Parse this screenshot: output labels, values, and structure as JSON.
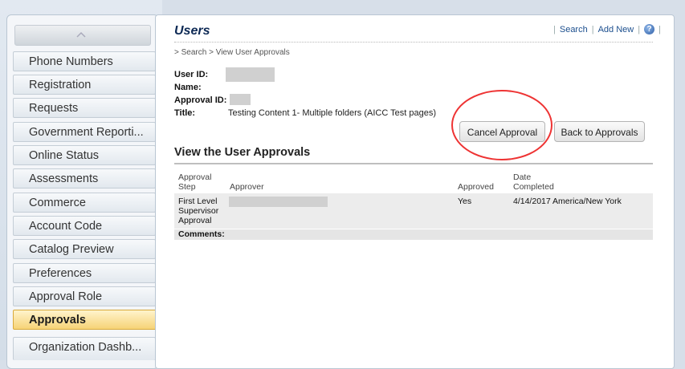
{
  "sidebar": {
    "items": [
      {
        "label": "Phone Numbers"
      },
      {
        "label": "Registration"
      },
      {
        "label": "Requests"
      },
      {
        "label": "Government Reporti..."
      },
      {
        "label": "Online Status"
      },
      {
        "label": "Assessments"
      },
      {
        "label": "Commerce"
      },
      {
        "label": "Account Code"
      },
      {
        "label": "Catalog Preview"
      },
      {
        "label": "Preferences"
      },
      {
        "label": "Approval Role"
      },
      {
        "label": "Approvals",
        "selected": true
      },
      {
        "label": "Organization Dashb..."
      }
    ]
  },
  "header": {
    "title": "Users",
    "links": {
      "search": "Search",
      "add_new": "Add New"
    },
    "help_icon": "help-icon"
  },
  "breadcrumb": "> Search > View User Approvals",
  "details": {
    "user_id_label": "User ID:",
    "name_label": "Name:",
    "approval_id_label": "Approval ID:",
    "title_label": "Title:",
    "title_value": "Testing Content 1- Multiple folders (AICC Test pages)"
  },
  "buttons": {
    "cancel_approval": "Cancel Approval",
    "back_to_approvals": "Back to Approvals"
  },
  "section": {
    "title": "View the User Approvals",
    "columns": {
      "approval_step": "Approval Step",
      "approver": "Approver",
      "approved": "Approved",
      "date_completed": "Date Completed"
    },
    "rows": [
      {
        "approval_step": "First Level Supervisor Approval",
        "approved": "Yes",
        "date_completed": "4/14/2017 America/New York"
      }
    ],
    "comments_label": "Comments:"
  },
  "colors": {
    "title": "#0e2a55",
    "link": "#1c4f8e",
    "selected_nav": "#f6d377",
    "highlight_circle": "#e33"
  }
}
